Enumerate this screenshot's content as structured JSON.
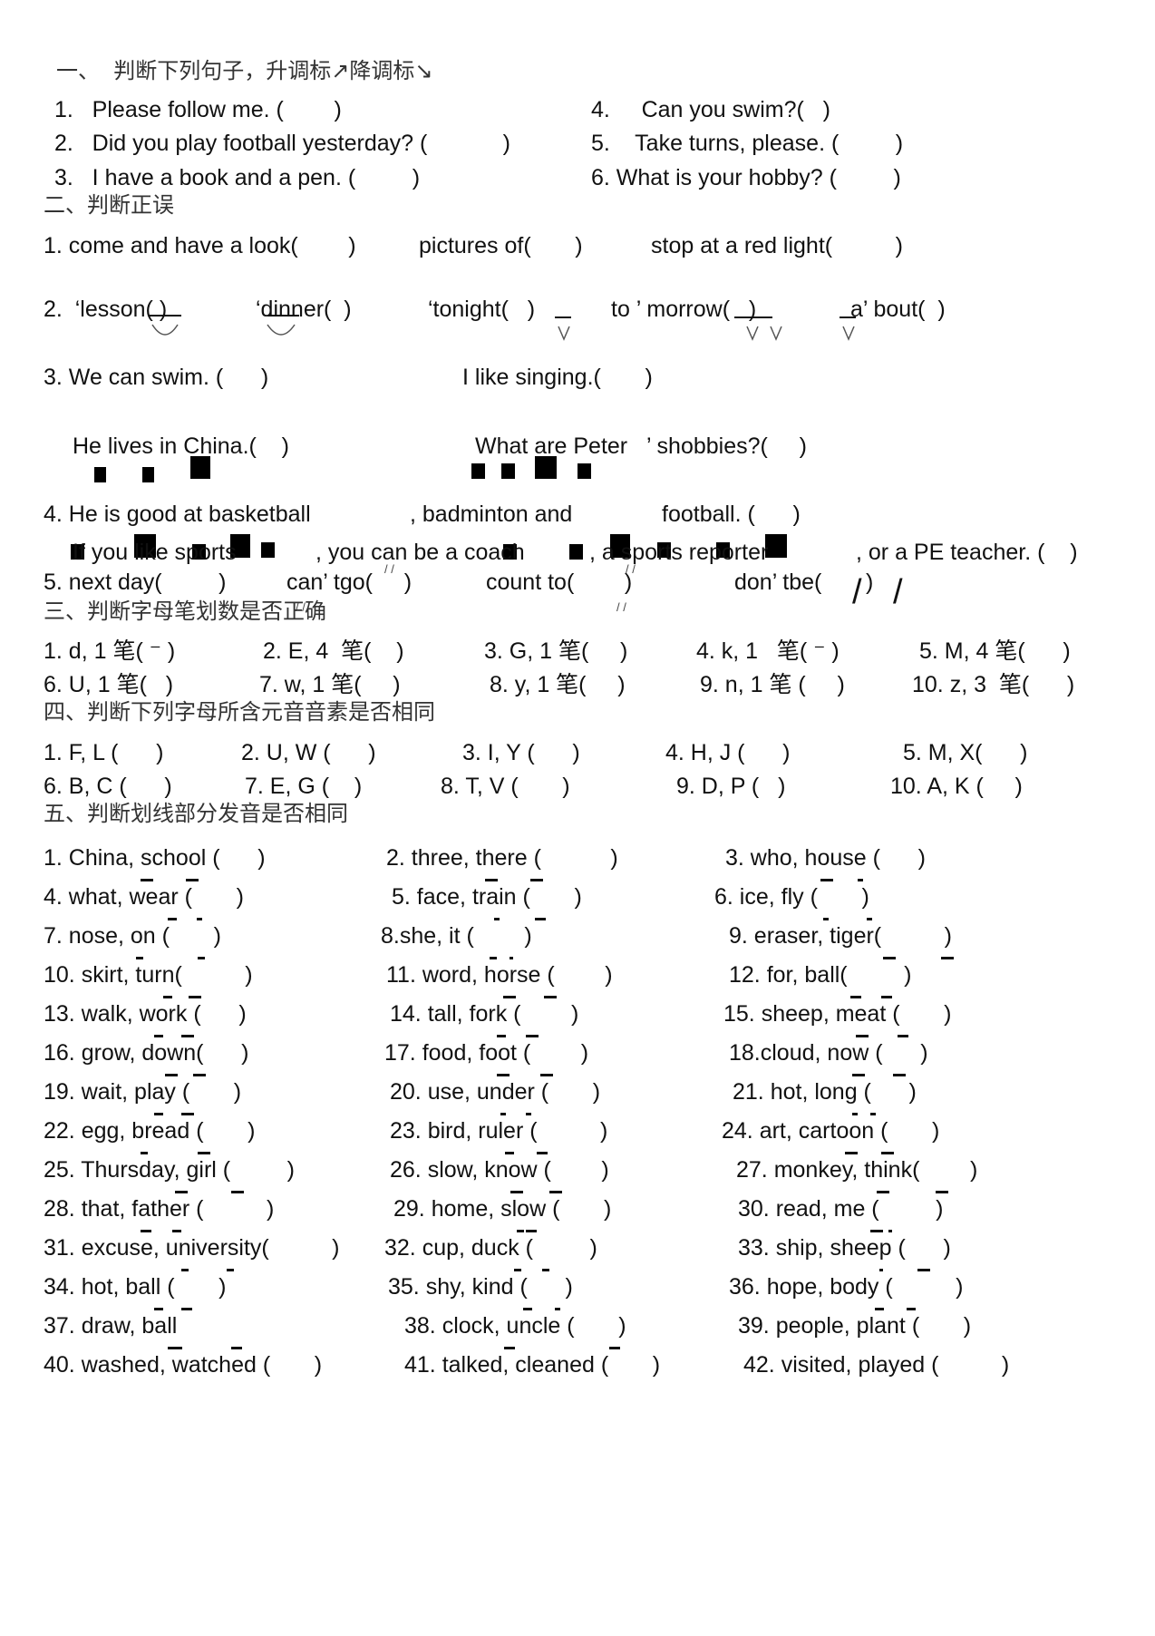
{
  "section1": {
    "heading": "一、  判断下列句子，升调标↗降调标↘",
    "items": [
      "1.   Please follow me. (        )",
      "2.   Did you play football yesterday? (            )",
      "3.   I have a book and a pen. (         )",
      "4.     Can you swim?(   )",
      "5.    Take turns, please. (         )",
      "6. What is your hobby? (         )"
    ]
  },
  "section2": {
    "heading": "二、判断正误",
    "line1": [
      "1. come and have a look(        )",
      "pictures of(       )",
      "stop at a red light(          )"
    ],
    "line2": [
      "2.  ‘lesson( )",
      "‘dinner(  )",
      "‘tonight(   )",
      "to ’ morrow(   )",
      "a’ bout(  )"
    ],
    "line3a": [
      "3. We can swim. (      )",
      "I like singing.(       )"
    ],
    "line3b": [
      "He lives in China.(    )",
      "What are Peter   ’ shobbies?(     )"
    ],
    "line4a": [
      "4. He is good at basketball",
      ", badminton and",
      "football. (      )"
    ],
    "line4b": [
      "If you like sports",
      ", you can be a coach",
      ", a sports reporter",
      ", or a PE teacher. (    )"
    ],
    "line5": [
      "5. next day(         )",
      "can’ tgo(     )",
      "count to(        )",
      "don’ tbe(       )"
    ]
  },
  "section3": {
    "heading": "三、判断字母笔划数是否正确",
    "row1": [
      "1. d, 1 笔( ⁻ )",
      "2. E, 4  笔(    )",
      "3. G, 1 笔(     )",
      "4. k, 1   笔( ⁻ )",
      "5. M, 4 笔(      )"
    ],
    "row2": [
      "6. U, 1 笔(   )",
      "7. w, 1 笔(     )",
      "8. y, 1 笔(     )",
      "9. n, 1 笔 (     )",
      "10. z, 3  笔(      )"
    ]
  },
  "section4": {
    "heading": "四、判断下列字母所含元音音素是否相同",
    "row1": [
      "1. F, L (      )",
      "2. U, W (      )",
      "3. I, Y (      )",
      "4. H, J (      )",
      "5. M, X(      )"
    ],
    "row2": [
      "6. B, C (      )",
      "7. E, G (    )",
      "8. T, V (       )",
      "9. D, P (   )",
      "10. A, K (     )"
    ]
  },
  "section5": {
    "heading": "五、判断划线部分发音是否相同",
    "items": [
      "1. China, school (      )",
      "2. three, there (           )",
      "3. who, house (      )",
      "4. what, wear (       )",
      "5. face, train (       )",
      "6. ice, fly (       )",
      "7. nose, on (       )",
      "8.she, it (        )",
      "9. eraser, tiger(          )",
      "10. skirt, turn(          )",
      "11. word, horse (        )",
      "12. for, ball(         )",
      "13. walk, work (      )",
      "14. tall, fork (        )",
      "15. sheep, meat (       )",
      "16. grow, down(      )",
      "17. food, foot (        )",
      "18.cloud, now (      )",
      "19. wait, play (       )",
      "20. use, under (       )",
      "21. hot, long (      )",
      "22. egg, bread (       )",
      "23. bird, ruler (          )",
      "24. art, cartoon (       )",
      "25. Thursday, girl (         )",
      "26. slow, know (        )",
      "27. monkey, think(        )",
      "28. that, father (          )",
      "29. home, slow (       )",
      "30. read, me (         )",
      "31. excuse, university(          )",
      "32. cup, duck (         )",
      "33. ship, sheep (      )",
      "34. hot, ball (       )",
      "35. shy, kind (      )",
      "36. hope, body (          )",
      "37. draw, ball",
      "38. clock, uncle (       )",
      "39. people, plant (       )",
      "40. washed, watched (       )",
      "41. talked, cleaned (       )",
      "42. visited, played (          )"
    ]
  }
}
